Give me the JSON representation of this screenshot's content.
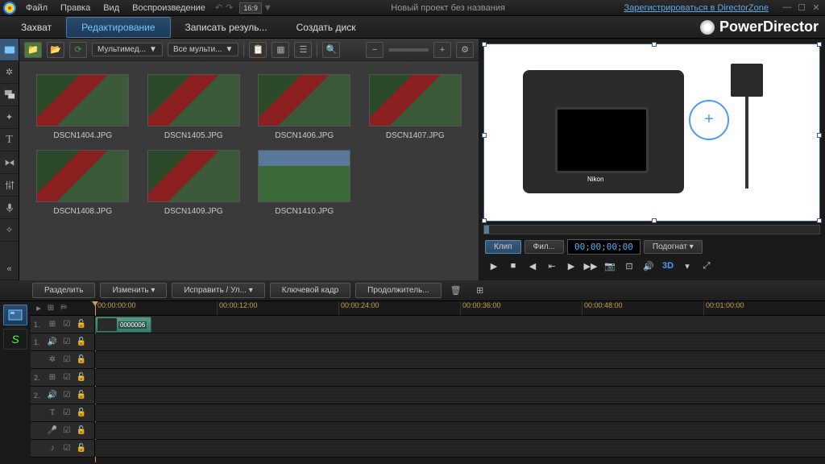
{
  "menu": {
    "file": "Файл",
    "edit": "Правка",
    "view": "Вид",
    "playback": "Воспроизведение"
  },
  "aspect": "16:9",
  "title": "Новый проект без названия",
  "registerLink": "Зарегистрироваться в DirectorZone",
  "brand": "PowerDirector",
  "tabs": {
    "capture": "Захват",
    "edit": "Редактирование",
    "produce": "Записать резуль...",
    "disc": "Создать диск"
  },
  "mediaToolbar": {
    "dd1": "Мультимед...",
    "dd2": "Все мульти..."
  },
  "thumbs": [
    "DSCN1404.JPG",
    "DSCN1405.JPG",
    "DSCN1406.JPG",
    "DSCN1407.JPG",
    "DSCN1408.JPG",
    "DSCN1409.JPG",
    "DSCN1410.JPG"
  ],
  "preview": {
    "clip": "Клип",
    "film": "Фил...",
    "timecode": "00;00;00;00",
    "fit": "Подогнат",
    "threeD": "3D"
  },
  "tlToolbar": {
    "split": "Разделить",
    "modify": "Изменить",
    "fix": "Исправить / Ул...",
    "keyframe": "Ключевой кадр",
    "duration": "Продолжитель..."
  },
  "ruler": [
    "00:00:00:00",
    "00:00:12:00",
    "00:00:24:00",
    "00:00:36:00",
    "00:00:48:00",
    "00:01:00:00"
  ],
  "clipLabel": "0000006",
  "modeFx": "S"
}
